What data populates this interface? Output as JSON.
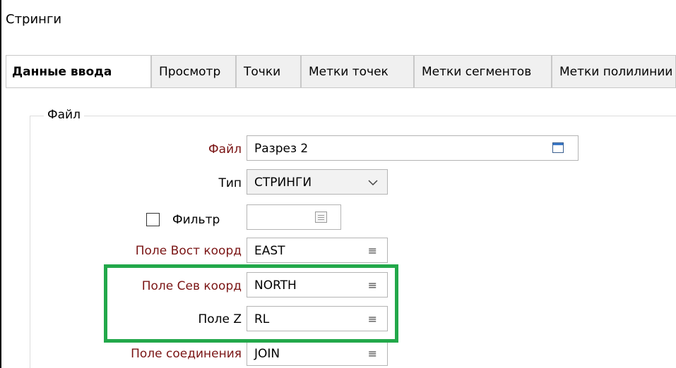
{
  "window": {
    "title": "Стринги"
  },
  "tabs": [
    {
      "label": "Данные ввода",
      "active": true
    },
    {
      "label": "Просмотр",
      "active": false
    },
    {
      "label": "Точки",
      "active": false
    },
    {
      "label": "Метки точек",
      "active": false
    },
    {
      "label": "Метки сегментов",
      "active": false
    },
    {
      "label": "Метки полилинии",
      "active": false
    }
  ],
  "file_group": {
    "title": "Файл",
    "file": {
      "label": "Файл",
      "value": "Разрез 2",
      "icon": "browse-file-icon"
    },
    "type": {
      "label": "Тип",
      "value": "СТРИНГИ",
      "icon": "chevron-down-icon"
    },
    "filter": {
      "label": "Фильтр",
      "checked": false,
      "value": "",
      "icon": "filter-list-icon"
    },
    "east": {
      "label": "Поле Вост коорд",
      "value": "EAST",
      "icon": "field-list-icon"
    },
    "north": {
      "label": "Поле Сев коорд",
      "value": "NORTH",
      "icon": "field-list-icon"
    },
    "z": {
      "label": "Поле Z",
      "value": "RL",
      "icon": "field-list-icon"
    },
    "join": {
      "label": "Поле соединения",
      "value": "JOIN",
      "icon": "field-list-icon"
    }
  },
  "colors": {
    "required_label": "#7a1414",
    "highlight": "#22a84a"
  }
}
